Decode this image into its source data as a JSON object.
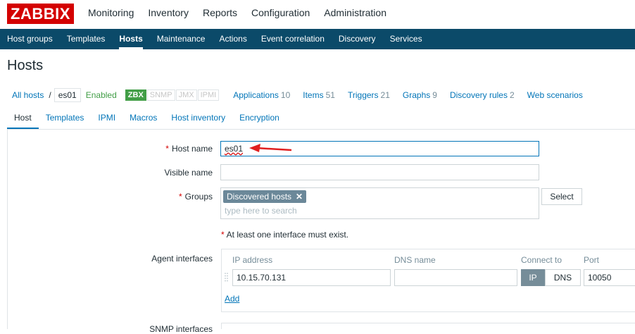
{
  "logo": {
    "text": "ZABBIX"
  },
  "main_nav": [
    "Monitoring",
    "Inventory",
    "Reports",
    "Configuration",
    "Administration"
  ],
  "sub_nav": [
    "Host groups",
    "Templates",
    "Hosts",
    "Maintenance",
    "Actions",
    "Event correlation",
    "Discovery",
    "Services"
  ],
  "page_title": "Hosts",
  "host_nav": {
    "all_hosts": "All hosts",
    "separator": "/",
    "host": "es01",
    "status": "Enabled",
    "availability": [
      "ZBX",
      "SNMP",
      "JMX",
      "IPMI"
    ],
    "links": [
      {
        "label": "Applications",
        "count": "10"
      },
      {
        "label": "Items",
        "count": "51"
      },
      {
        "label": "Triggers",
        "count": "21"
      },
      {
        "label": "Graphs",
        "count": "9"
      },
      {
        "label": "Discovery rules",
        "count": "2"
      },
      {
        "label": "Web scenarios",
        "count": ""
      }
    ]
  },
  "tabs": [
    "Host",
    "Templates",
    "IPMI",
    "Macros",
    "Host inventory",
    "Encryption"
  ],
  "form": {
    "host_name_label": "Host name",
    "host_name_value": "es01",
    "visible_name_label": "Visible name",
    "visible_name_value": "",
    "groups_label": "Groups",
    "group_tag": "Discovered hosts",
    "groups_placeholder": "type here to search",
    "select_button": "Select",
    "interface_warning": "At least one interface must exist.",
    "required_mark": "*",
    "agent_label": "Agent interfaces",
    "snmp_label": "SNMP interfaces",
    "columns": {
      "ip": "IP address",
      "dns": "DNS name",
      "connect": "Connect to",
      "port": "Port"
    },
    "agent_row": {
      "ip": "10.15.70.131",
      "dns": "",
      "connect_ip": "IP",
      "connect_dns": "DNS",
      "port": "10050"
    },
    "add_link": "Add"
  },
  "colors": {
    "nav_bg": "#0b4a69",
    "link": "#0275b8",
    "brand": "#d40000",
    "enabled": "#429e47"
  }
}
